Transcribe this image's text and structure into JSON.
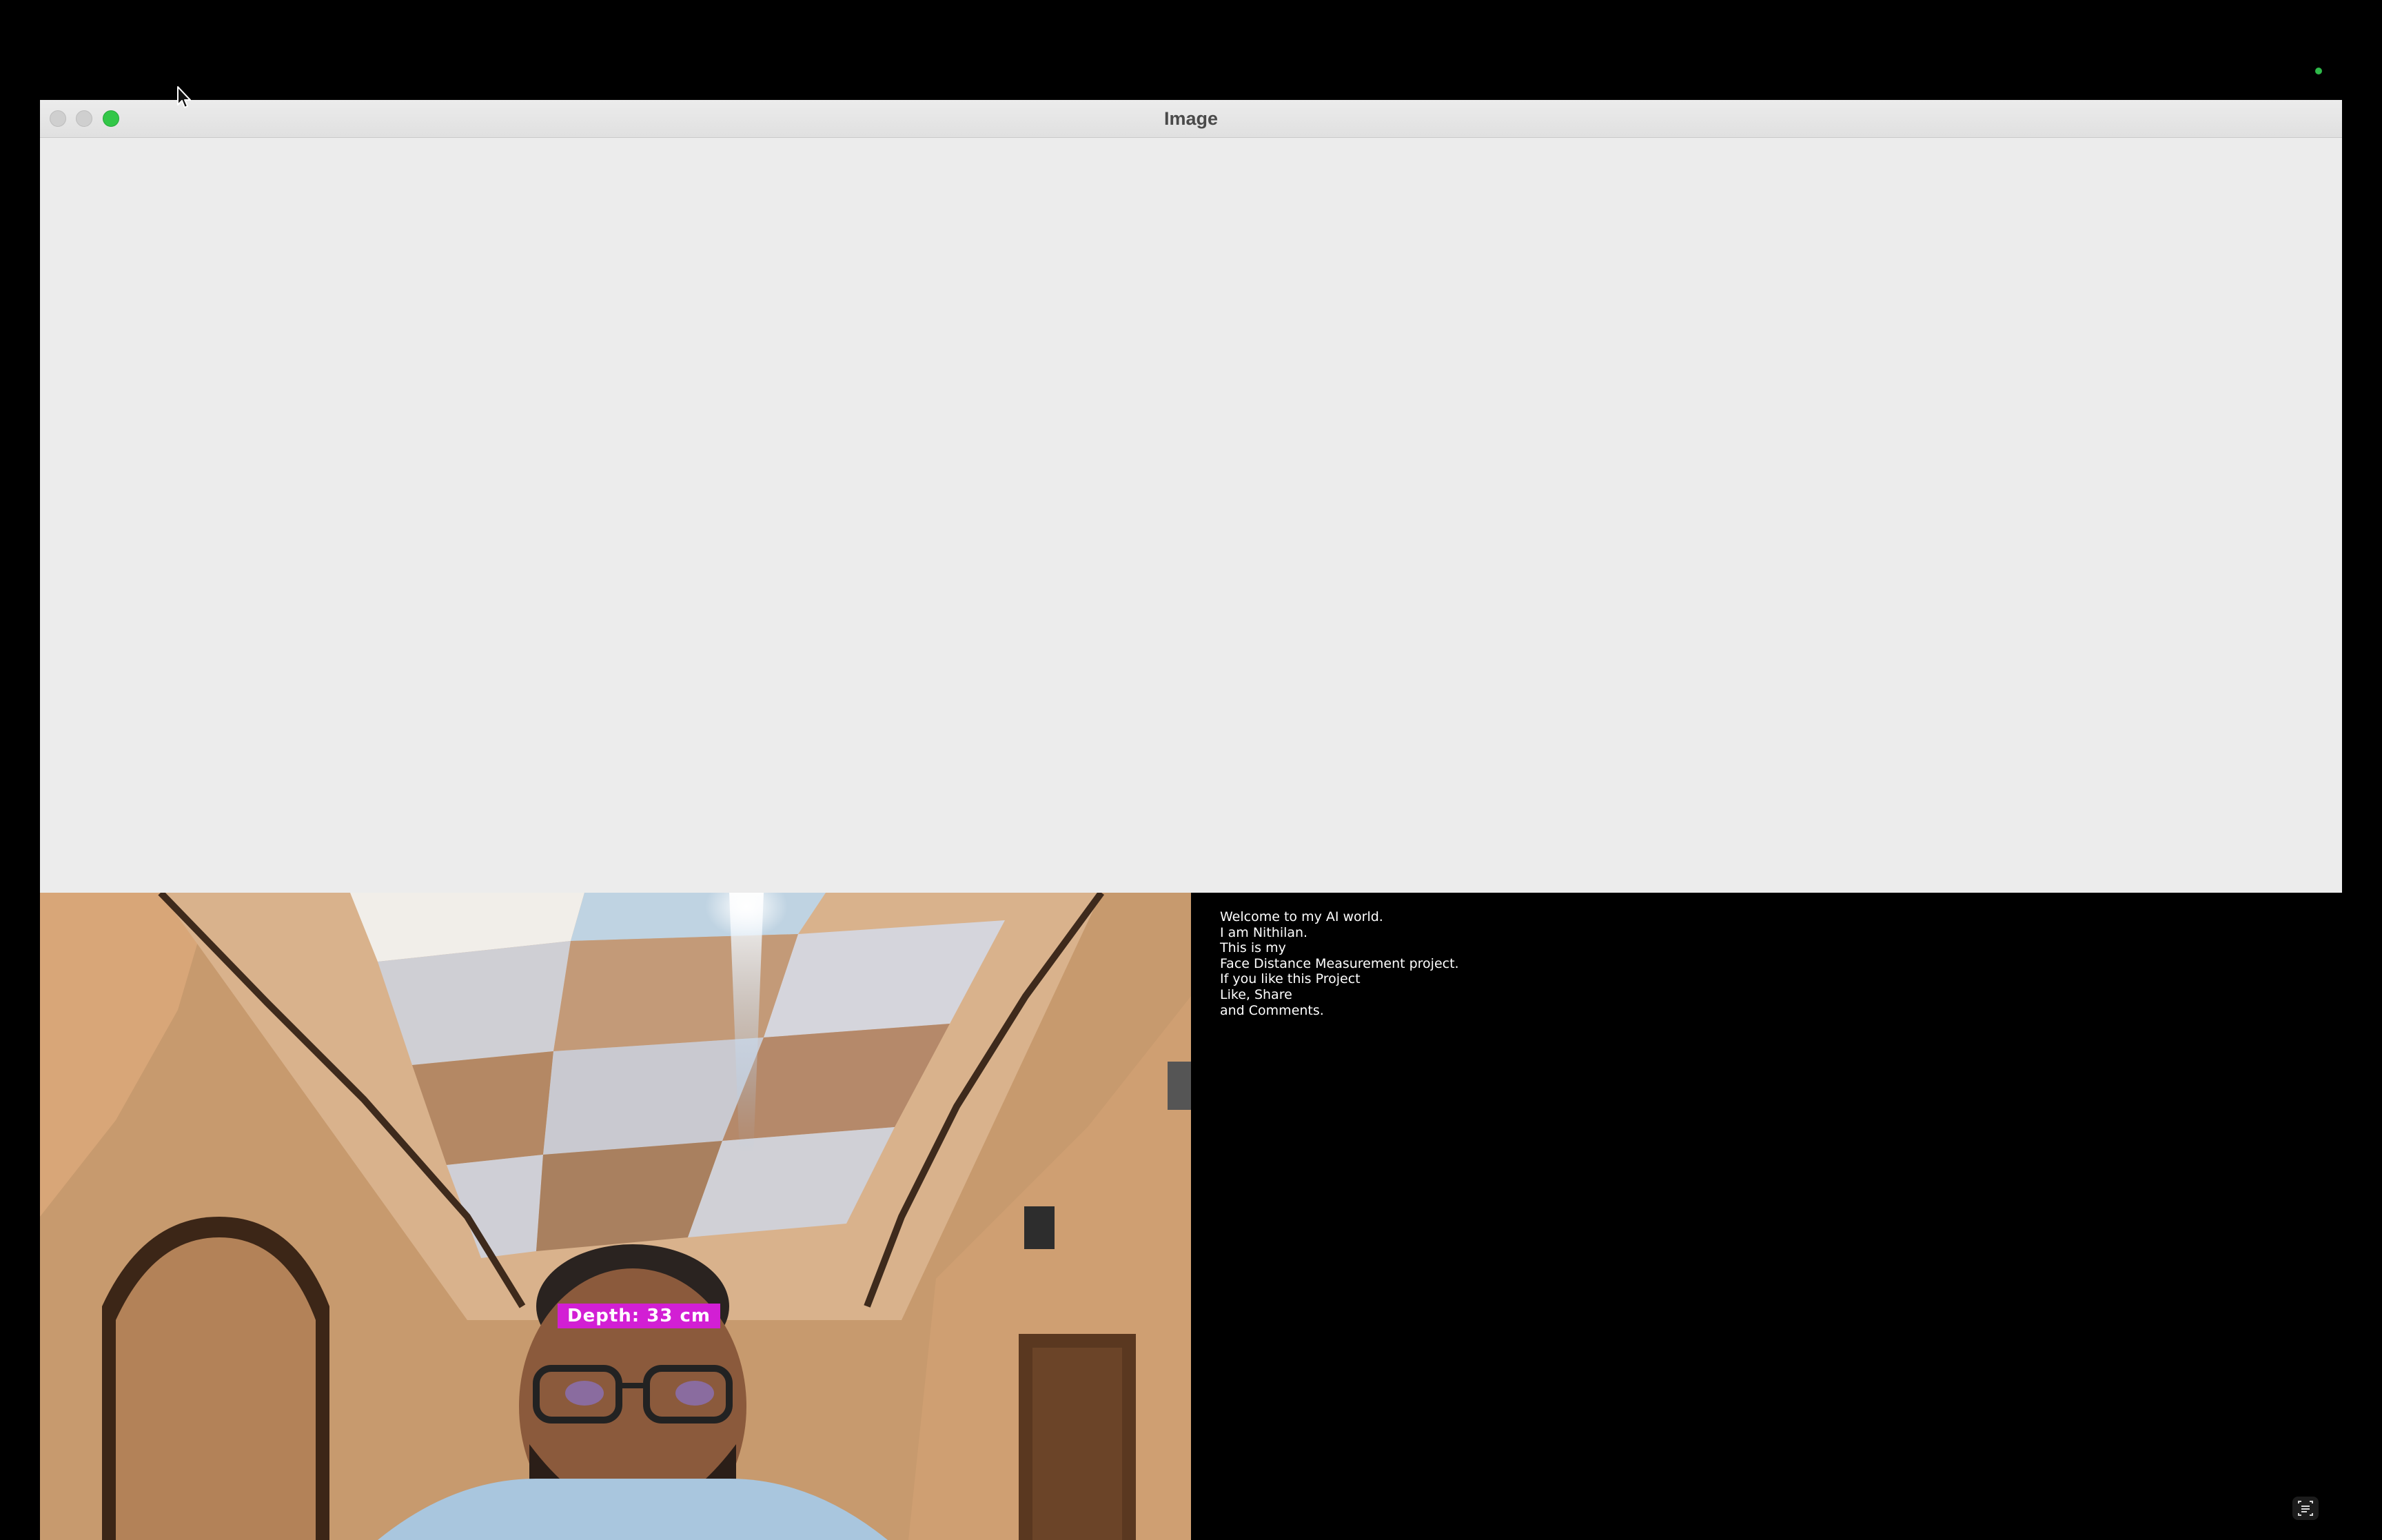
{
  "window": {
    "title": "Image"
  },
  "camera": {
    "depth_label": "Depth: 33 cm"
  },
  "message": {
    "lines": [
      "Welcome to my AI world.",
      "I am Nithilan.",
      "This is my",
      "Face Distance Measurement project.",
      "If you like this Project",
      "Like, Share",
      "and Comments."
    ]
  },
  "icons": {
    "cursor": "arrow-cursor-icon",
    "close": "close-button",
    "minimize": "minimize-button",
    "zoom": "zoom-button",
    "status": "recording-indicator-icon",
    "screen_capture": "screen-capture-icon"
  },
  "colors": {
    "depth_label_bg": "#d21fd4",
    "zoom_button": "#33c748",
    "status_dot": "#2fb94a"
  }
}
